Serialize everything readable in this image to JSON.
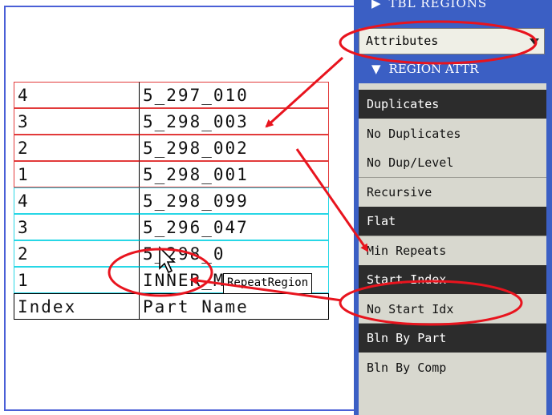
{
  "table": {
    "rows": [
      {
        "index": "4",
        "part": "5_297_010"
      },
      {
        "index": "3",
        "part": "5_298_003"
      },
      {
        "index": "2",
        "part": "5_298_002"
      },
      {
        "index": "1",
        "part": "5_298_001"
      },
      {
        "index": "4",
        "part": "5_298_099"
      },
      {
        "index": "3",
        "part": "5_296_047"
      },
      {
        "index": "2",
        "part": "5_298_0"
      },
      {
        "index": "1",
        "part": "INNER_MECH"
      },
      {
        "index": "Index",
        "part": "Part Name"
      }
    ]
  },
  "tooltip": "RepeatRegion",
  "panel": {
    "top_header": "TBL REGIONS",
    "dropdown_value": "Attributes",
    "section_header": "REGION ATTR",
    "items": [
      {
        "label": "Duplicates",
        "selected": true
      },
      {
        "label": "No Duplicates",
        "selected": false
      },
      {
        "label": "No Dup/Level",
        "selected": false
      },
      {
        "label": "Recursive",
        "selected": false
      },
      {
        "label": "Flat",
        "selected": true
      },
      {
        "label": "Min Repeats",
        "selected": false
      },
      {
        "label": "Start Index",
        "selected": true
      },
      {
        "label": "No Start Idx",
        "selected": false
      },
      {
        "label": "Bln By Part",
        "selected": true
      },
      {
        "label": "Bln By Comp",
        "selected": false
      }
    ]
  },
  "colors": {
    "panel_blue": "#3b5fc4",
    "annotation_red": "#e8141e",
    "region_red": "#e23a3a",
    "region_cyan": "#27d7e6",
    "selected_item": "#2c2c2c"
  }
}
